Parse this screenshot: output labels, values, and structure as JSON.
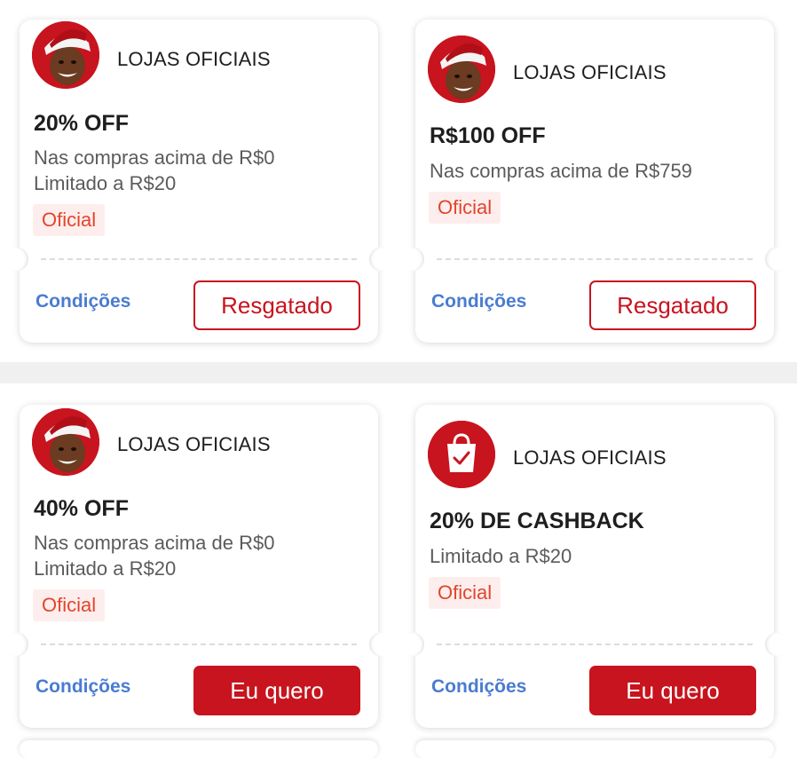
{
  "cards": [
    {
      "store": "LOJAS OFICIAIS",
      "avatar_icon": "santa-avatar-icon",
      "title": "20% OFF",
      "desc1": "Nas compras acima de R$0",
      "desc2": "Limitado a R$20",
      "badge": "Oficial",
      "conditions": "Condições",
      "button": "Resgatado",
      "button_state": "redeemed"
    },
    {
      "store": "LOJAS OFICIAIS",
      "avatar_icon": "santa-avatar-icon",
      "title": "R$100 OFF",
      "desc1": "Nas compras acima de R$759",
      "badge": "Oficial",
      "conditions": "Condições",
      "button": "Resgatado",
      "button_state": "redeemed"
    },
    {
      "store": "LOJAS OFICIAIS",
      "avatar_icon": "santa-avatar-icon",
      "title": "40% OFF",
      "desc1": "Nas compras acima de R$0",
      "desc2": "Limitado a R$20",
      "badge": "Oficial",
      "conditions": "Condições",
      "button": "Eu quero",
      "button_state": "available"
    },
    {
      "store": "LOJAS OFICIAIS",
      "avatar_icon": "shopping-bag-check-icon",
      "title": "20% DE CASHBACK",
      "desc1": "Limitado a R$20",
      "badge": "Oficial",
      "conditions": "Condições",
      "button": "Eu quero",
      "button_state": "available"
    }
  ],
  "colors": {
    "brand_red": "#c8141e",
    "link_blue": "#4a7cd1",
    "badge_text": "#e2452b",
    "badge_bg": "#fdeeed"
  }
}
